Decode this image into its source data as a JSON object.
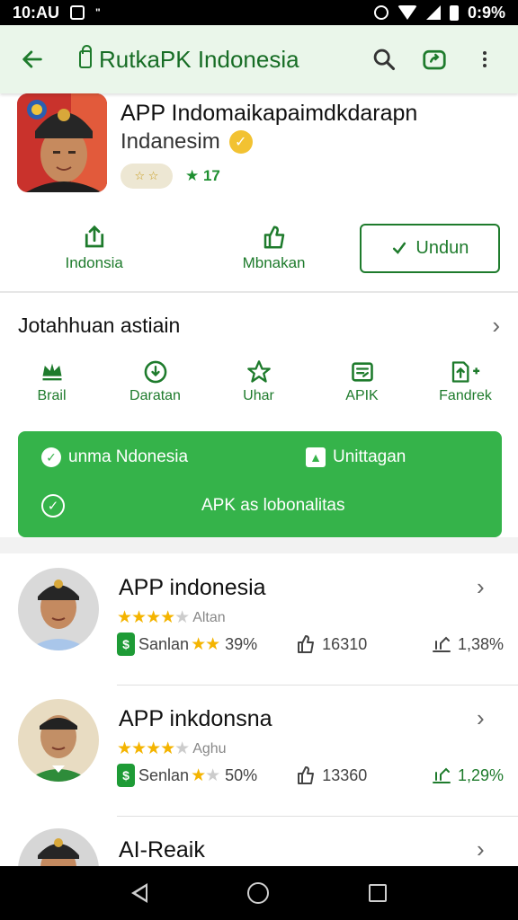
{
  "status_bar": {
    "time": "10:AU",
    "dots": "\"",
    "battery_text": "0:9%"
  },
  "app_bar": {
    "title": "RutkaPK Indonesia"
  },
  "app": {
    "name": "APP Indomaikapaimdkdarapn",
    "developer": "Indanesim",
    "rating_pill": "☆ ☆ ",
    "size": "★ 17"
  },
  "actions": [
    {
      "label": "Indonsia",
      "icon": "share-icon"
    },
    {
      "label": "Mbnakan",
      "icon": "thumbs-up-icon"
    }
  ],
  "download_button": {
    "label": "Undun"
  },
  "categories_section": {
    "title": "Jotahhuan astiain",
    "items": [
      {
        "label": "Brail",
        "icon": "crown-icon"
      },
      {
        "label": "Daratan",
        "icon": "download-circle-icon"
      },
      {
        "label": "Uhar",
        "icon": "star-icon"
      },
      {
        "label": "APIK",
        "icon": "document-icon"
      },
      {
        "label": "Fandrek",
        "icon": "upload-icon"
      }
    ]
  },
  "promo": {
    "line1_left": "unma Ndonesia",
    "line1_right": "Unittagan",
    "line2": "APK as lobonalitas"
  },
  "list": [
    {
      "title": "APP indonesia",
      "rating_stars": 4,
      "rating_label": "Altan",
      "tag_label": "Sanlan",
      "stat1": "39%",
      "stat2": "16310",
      "stat3": "1,38%"
    },
    {
      "title": "APP inkdonsna",
      "rating_stars": 4,
      "rating_label": "Aghu",
      "tag_label": "Senlan",
      "stat1": "50%",
      "stat2": "13360",
      "stat3": "1,29%"
    },
    {
      "title": "AI-Reaik"
    }
  ],
  "colors": {
    "brand_green": "#1e7b2c",
    "promo_green": "#35b34a",
    "star_gold": "#f4b400",
    "app_bar_bg": "#eaf6ea"
  }
}
